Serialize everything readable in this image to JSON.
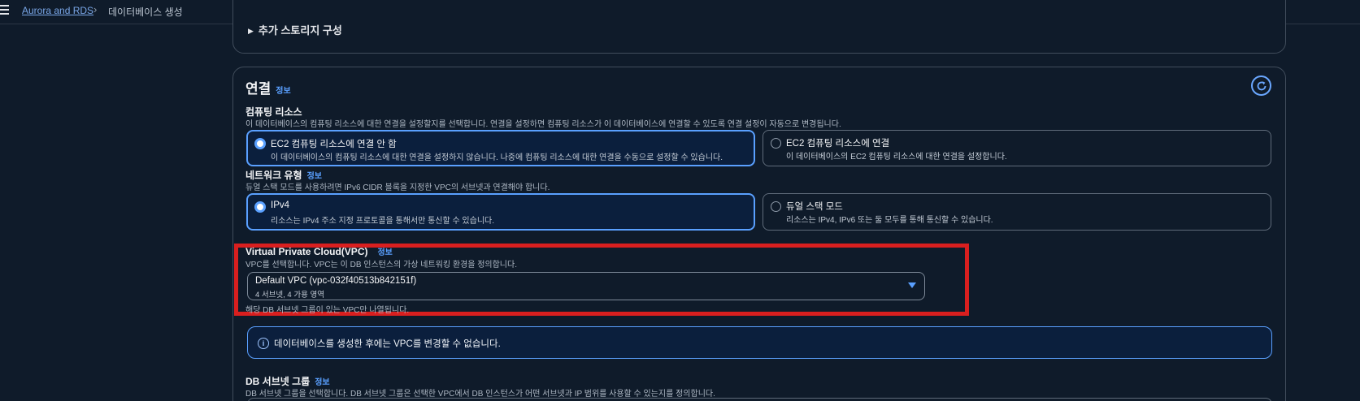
{
  "breadcrumb": {
    "root": "Aurora and RDS",
    "current": "데이터베이스 생성"
  },
  "storage": {
    "expand_label": "추가 스토리지 구성"
  },
  "connectivity": {
    "title": "연결",
    "info": "정보",
    "compute": {
      "title": "컴퓨팅 리소스",
      "description": "이 데이터베이스의 컴퓨팅 리소스에 대한 연결을 설정할지를 선택합니다. 연결을 설정하면 컴퓨팅 리소스가 이 데이터베이스에 연결할 수 있도록 연결 설정이 자동으로 변경됩니다.",
      "options": [
        {
          "label": "EC2 컴퓨팅 리소스에 연결 안 함",
          "description": "이 데이터베이스의 컴퓨팅 리소스에 대한 연결을 설정하지 않습니다. 나중에 컴퓨팅 리소스에 대한 연결을 수동으로 설정할 수 있습니다.",
          "selected": true
        },
        {
          "label": "EC2 컴퓨팅 리소스에 연결",
          "description": "이 데이터베이스의 EC2 컴퓨팅 리소스에 대한 연결을 설정합니다.",
          "selected": false
        }
      ]
    },
    "network_type": {
      "title": "네트워크 유형",
      "info": "정보",
      "description": "듀얼 스택 모드를 사용하려면 IPv6 CIDR 블록을 지정한 VPC의 서브넷과 연결해야 합니다.",
      "options": [
        {
          "label": "IPv4",
          "description": "리소스는 IPv4 주소 지정 프로토콜을 통해서만 통신할 수 있습니다.",
          "selected": true
        },
        {
          "label": "듀얼 스택 모드",
          "description": "리소스는 IPv4, IPv6 또는 둘 모두를 통해 통신할 수 있습니다.",
          "selected": false
        }
      ]
    },
    "vpc": {
      "title": "Virtual Private Cloud(VPC)",
      "info": "정보",
      "description": "VPC를 선택합니다. VPC는 이 DB 인스턴스의 가상 네트워킹 환경을 정의합니다.",
      "selected_value": "Default VPC (vpc-032f40513b842151f)",
      "selected_sub": "4 서브넷, 4 가용 영역",
      "hint": "해당 DB 서브넷 그룹이 있는 VPC만 나열됩니다."
    },
    "alert": {
      "text": "데이터베이스를 생성한 후에는 VPC를 변경할 수 없습니다."
    },
    "subnet_group": {
      "title": "DB 서브넷 그룹",
      "info": "정보",
      "description": "DB 서브넷 그룹을 선택합니다. DB 서브넷 그룹은 선택한 VPC에서 DB 인스턴스가 어떤 서브넷과 IP 범위를 사용할 수 있는지를 정의합니다."
    }
  },
  "colors": {
    "background": "#0f1b2a",
    "accent": "#5aa0ff",
    "highlight_box": "#d91f1f"
  }
}
